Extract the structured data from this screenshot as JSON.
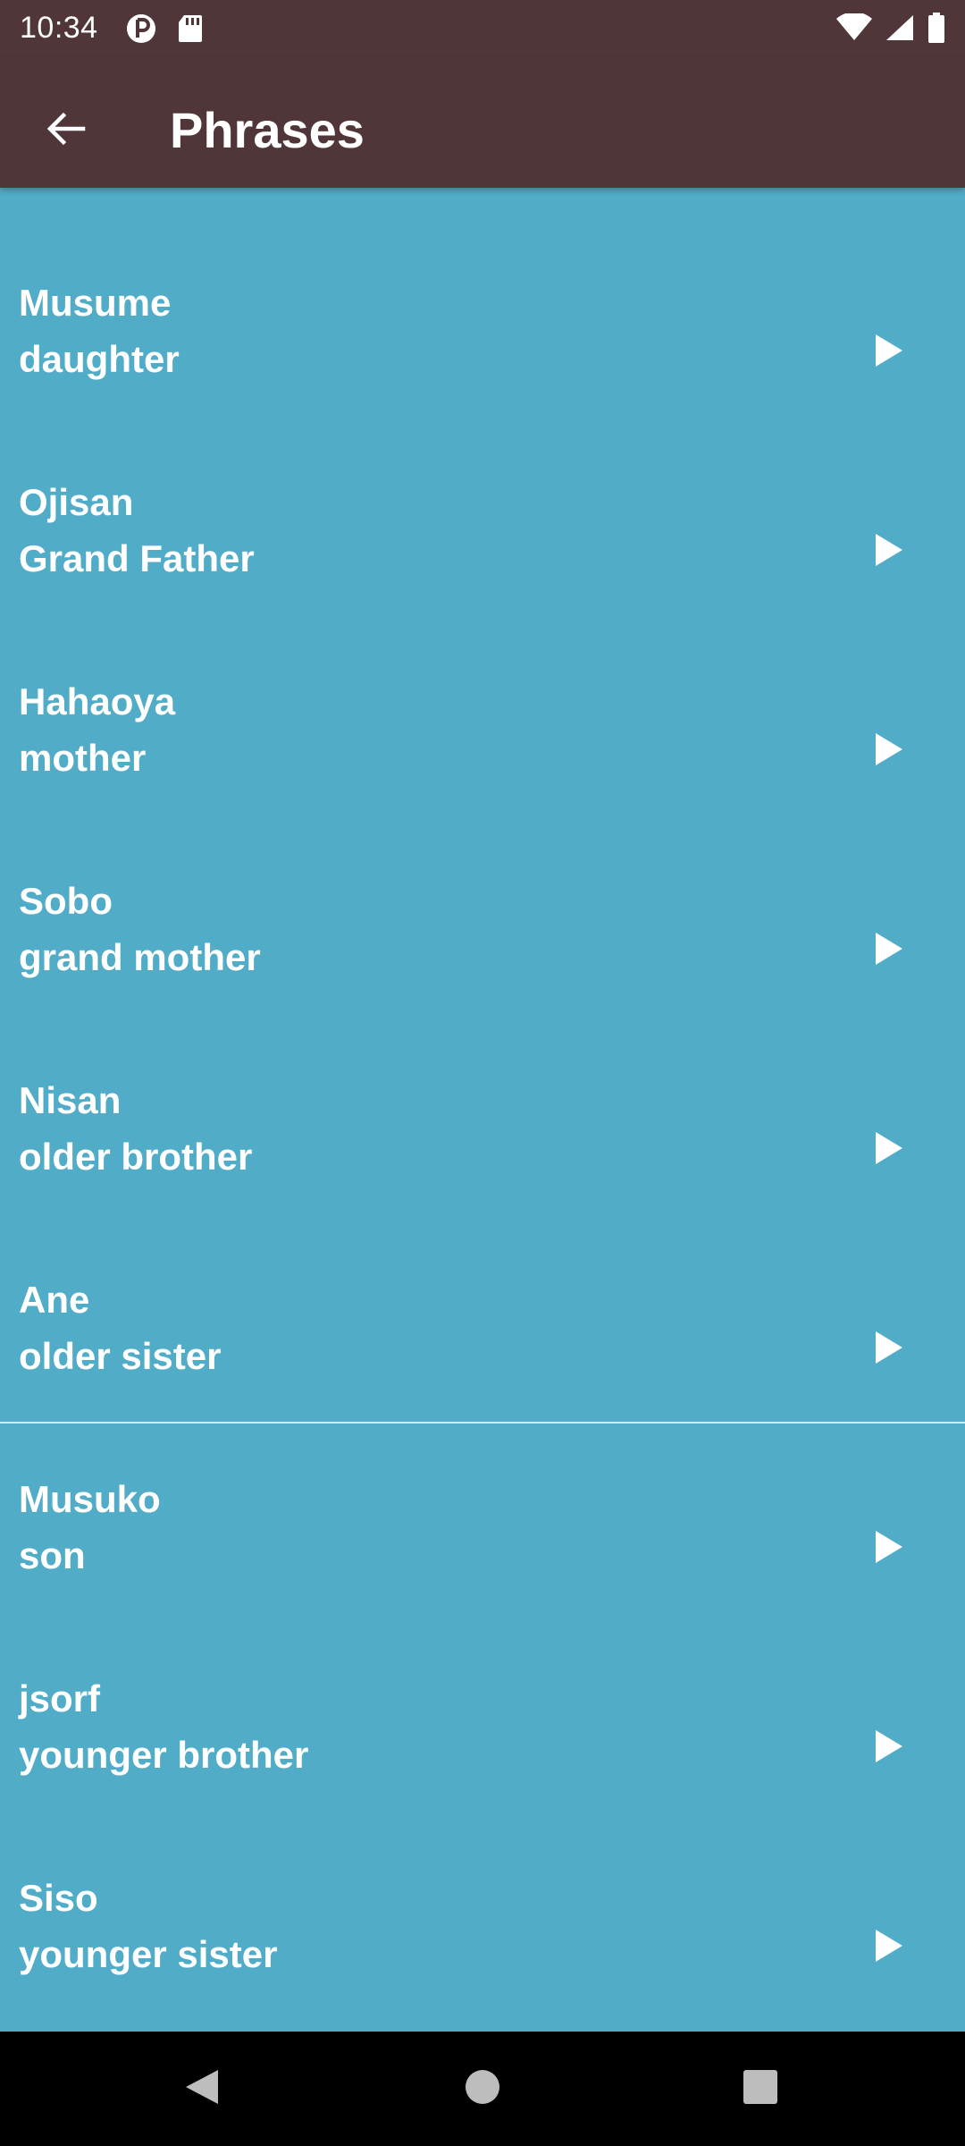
{
  "status_bar": {
    "time": "10:34",
    "icons": [
      "data-saver-icon",
      "sd-card-icon",
      "wifi-icon",
      "signal-icon",
      "battery-icon"
    ]
  },
  "app_bar": {
    "back_icon": "arrow-back-icon",
    "title": "Phrases"
  },
  "phrases": [
    {
      "phrase": "Musume",
      "meaning": "daughter"
    },
    {
      "phrase": "Ojisan",
      "meaning": "Grand Father"
    },
    {
      "phrase": "Hahaoya",
      "meaning": "mother"
    },
    {
      "phrase": "Sobo",
      "meaning": "grand mother"
    },
    {
      "phrase": "Nisan",
      "meaning": "older brother"
    },
    {
      "phrase": "Ane",
      "meaning": "older sister"
    },
    {
      "phrase": "Musuko",
      "meaning": "son"
    },
    {
      "phrase": "jsorf",
      "meaning": "younger brother"
    },
    {
      "phrase": "Siso",
      "meaning": "younger sister"
    }
  ],
  "nav_bar": {
    "icons": [
      "nav-back-icon",
      "nav-home-icon",
      "nav-recents-icon"
    ]
  },
  "colors": {
    "app_bar": "#503638",
    "list_background": "#51ACC7",
    "text": "#FFFFFF"
  }
}
